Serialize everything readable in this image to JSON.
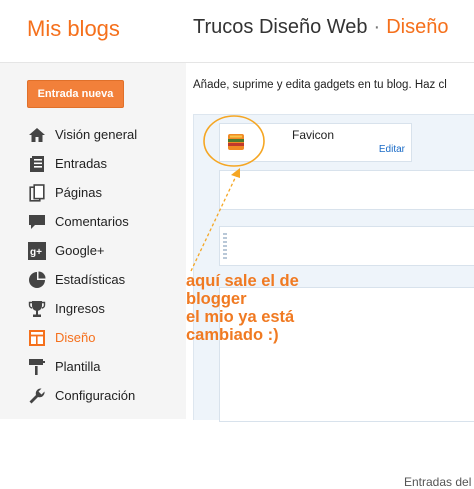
{
  "header": {
    "brand": "Mis blogs",
    "blog_name": "Trucos Diseño Web",
    "separator": "·",
    "section": "Diseño"
  },
  "sidebar": {
    "new_post_label": "Entrada nueva",
    "items": [
      {
        "label": "Visión general",
        "icon": "home-icon"
      },
      {
        "label": "Entradas",
        "icon": "posts-icon"
      },
      {
        "label": "Páginas",
        "icon": "pages-icon"
      },
      {
        "label": "Comentarios",
        "icon": "comments-icon"
      },
      {
        "label": "Google+",
        "icon": "google-plus-icon"
      },
      {
        "label": "Estadísticas",
        "icon": "stats-icon"
      },
      {
        "label": "Ingresos",
        "icon": "trophy-icon"
      },
      {
        "label": "Diseño",
        "icon": "layout-icon",
        "active": true
      },
      {
        "label": "Plantilla",
        "icon": "template-icon"
      },
      {
        "label": "Configuración",
        "icon": "wrench-icon"
      }
    ]
  },
  "main": {
    "description": "Añade, suprime y edita gadgets en tu blog. Haz cl",
    "favicon_gadget": {
      "name": "Favicon",
      "edit_label": "Editar"
    },
    "entries_label": "Entradas del blo"
  },
  "annotation": {
    "lines": [
      "aquí sale el de",
      "blogger",
      "el mio ya está",
      "cambiado :)"
    ]
  },
  "colors": {
    "accent": "#f5701c",
    "annotation": "#f07a22",
    "link": "#1a6bc7"
  }
}
